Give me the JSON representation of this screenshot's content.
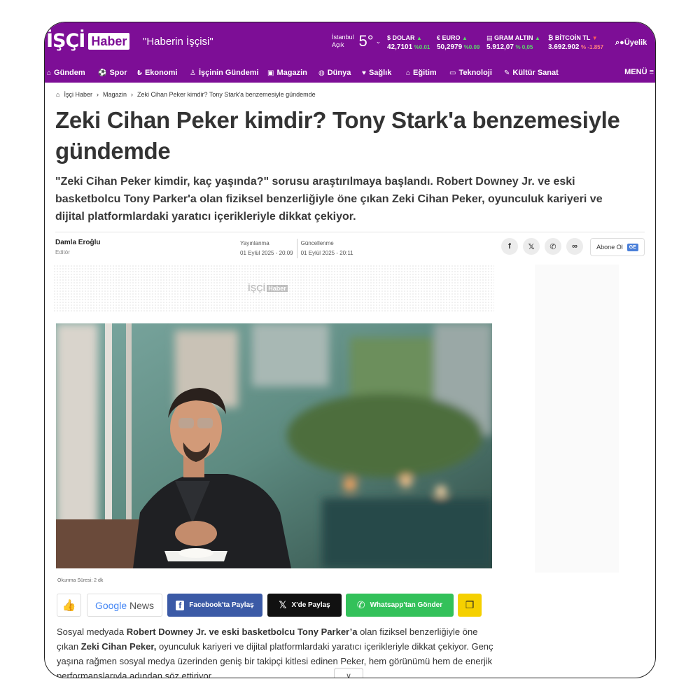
{
  "header": {
    "logo_main": "İŞÇİ",
    "logo_sub": "Haber",
    "slogan": "\"Haberin İşçisi\"",
    "weather": {
      "city": "İstanbul",
      "condition": "Açık",
      "temp": "5°"
    },
    "rates": [
      {
        "label": "$ DOLAR",
        "value": "42,7101",
        "change": "%0.01",
        "trend": "up"
      },
      {
        "label": "€ EURO",
        "value": "50,2979",
        "change": "%0.09",
        "trend": "up"
      },
      {
        "label": "GRAM ALTIN",
        "value": "5.912,07",
        "change": "% 0,05",
        "trend": "up"
      },
      {
        "label": "₿ BİTCOİN TL",
        "value": "3.692.902",
        "change": "% -1.857",
        "trend": "down"
      }
    ],
    "member_label": "Üyelik"
  },
  "nav": {
    "items": [
      "Gündem",
      "Spor",
      "Ekonomi",
      "İşçinin Gündemi",
      "Magazin",
      "Dünya",
      "Sağlık",
      "Eğitim",
      "Teknoloji",
      "Kültür Sanat"
    ],
    "menu_label": "MENÜ"
  },
  "breadcrumb": [
    "İşçi Haber",
    "Magazin",
    "Zeki Cihan Peker kimdir? Tony Stark'a benzemesiyle gündemde"
  ],
  "article": {
    "title": "Zeki Cihan Peker kimdir? Tony Stark'a benzemesiyle gündemde",
    "lead": "\"Zeki Cihan Peker kimdir, kaç yaşında?\" sorusu araştırılmaya başlandı. Robert Downey Jr. ve eski basketbolcu Tony Parker'a olan fiziksel benzerliğiyle öne çıkan Zeki Cihan Peker, oyunculuk kariyeri ve dijital platformlardaki yaratıcı içerikleriyle dikkat çekiyor.",
    "author_name": "Damla Eroğlu",
    "author_role": "Editör",
    "published_label": "Yayınlanma",
    "published_date": "01 Eylül 2025 - 20:09",
    "updated_label": "Güncellenme",
    "updated_date": "01 Eylül 2025 - 20:11",
    "subscribe_label": "Abone Ol",
    "subscribe_badge": "GE",
    "ad_logo_main": "İŞÇİ",
    "ad_logo_sub": "Haber",
    "reading_time": "Okunma Süresi: 2 dk",
    "body_p1_a": "Sosyal medyada ",
    "body_p1_b": "Robert Downey Jr. ve eski basketbolcu Tony Parker’a",
    "body_p1_c": " olan fiziksel benzerliğiyle öne çıkan ",
    "body_p1_d": "Zeki Cihan Peker,",
    "body_p1_e": " oyunculuk kariyeri ve dijital platformlardaki yaratıcı içerikleriyle dikkat çekiyor. Genç yaşına rağmen sosyal medya üzerinden geniş bir takipçi kitlesi edinen Peker, hem görünümü hem de enerjik performanslarıyla adından söz ettiriyor."
  },
  "share_buttons": {
    "facebook": "Facebook'ta Paylaş",
    "x": "X'de Paylaş",
    "whatsapp": "Whatsapp'tan Gönder",
    "gnews_google": "Google",
    "gnews_news": "News"
  },
  "icons": [
    "home-icon",
    "soccer-icon",
    "money-icon",
    "worker-icon",
    "magazine-icon",
    "globe-icon",
    "heart-icon",
    "graduation-icon",
    "monitor-icon",
    "culture-icon",
    "search-icon",
    "user-icon",
    "facebook-icon",
    "x-icon",
    "whatsapp-icon",
    "link-icon",
    "thumbs-up-icon",
    "copy-icon",
    "chevron-down-icon"
  ],
  "colors": {
    "brand": "#7d0e96",
    "facebook": "#3b5aa6",
    "whatsapp": "#33c15a",
    "copy": "#f5d000"
  }
}
